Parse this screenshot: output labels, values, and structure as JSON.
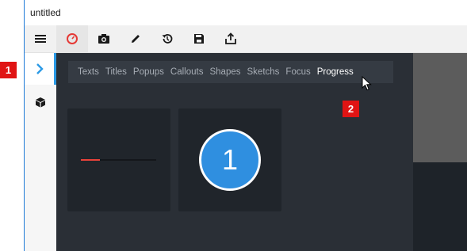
{
  "window": {
    "title": "untitled"
  },
  "toolbar": {
    "buttons": [
      {
        "name": "menu-icon",
        "color": "#1a1a1a"
      },
      {
        "name": "record-icon",
        "color": "#e53935"
      },
      {
        "name": "camera-icon",
        "color": "#1a1a1a"
      },
      {
        "name": "pencil-icon",
        "color": "#1a1a1a"
      },
      {
        "name": "history-icon",
        "color": "#1a1a1a"
      },
      {
        "name": "save-icon",
        "color": "#1a1a1a"
      },
      {
        "name": "share-icon",
        "color": "#1a1a1a"
      }
    ]
  },
  "sidebar": {
    "items": [
      {
        "name": "chevron-right-icon",
        "active": true,
        "color": "#2b9ae6"
      },
      {
        "name": "cube-icon",
        "active": false,
        "color": "#1a1a1a"
      }
    ]
  },
  "tabs": {
    "items": [
      "Texts",
      "Titles",
      "Popups",
      "Callouts",
      "Shapes",
      "Sketchs",
      "Focus",
      "Progress"
    ],
    "active": "Progress"
  },
  "cards": {
    "progress_bar": {
      "level_percent": 25,
      "fill_color": "#e8423a"
    },
    "step_badge": {
      "value": "1",
      "color": "#2f8fe0"
    }
  },
  "callouts": {
    "one": "1",
    "two": "2"
  }
}
